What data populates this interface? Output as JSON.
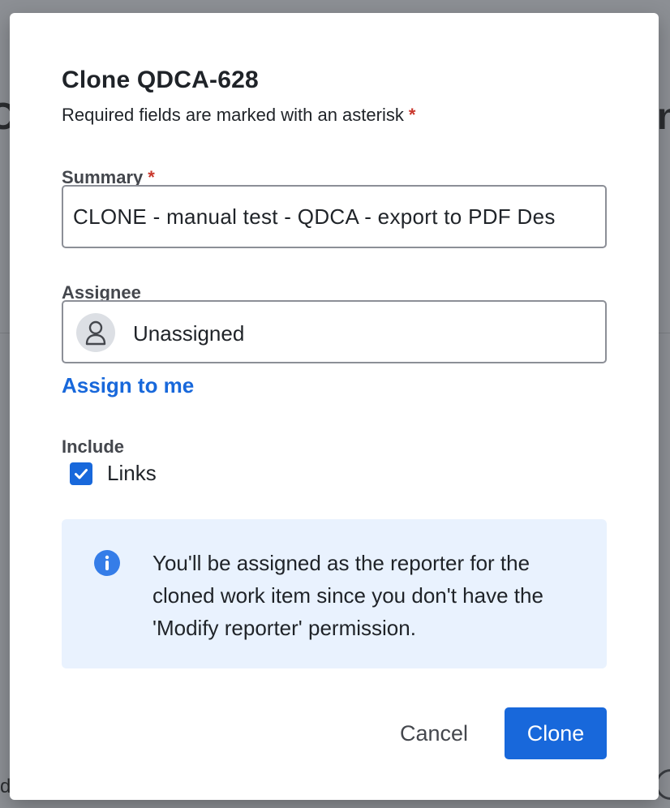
{
  "background": {
    "left_fragment": "C",
    "right_fragment": "n",
    "bottom_fragment": "d"
  },
  "dialog": {
    "title": "Clone QDCA-628",
    "required_note": "Required fields are marked with an asterisk",
    "required_marker": "*"
  },
  "summary": {
    "label": "Summary",
    "required_marker": "*",
    "value": "CLONE - manual test - QDCA - export to PDF Des"
  },
  "assignee": {
    "label": "Assignee",
    "value": "Unassigned",
    "avatar_icon": "person-icon",
    "assign_to_me": "Assign to me"
  },
  "include": {
    "label": "Include",
    "links_label": "Links",
    "links_checked": true
  },
  "info": {
    "icon": "info-icon",
    "message": "You'll be assigned as the reporter for the cloned work item since you don't have the 'Modify reporter' permission."
  },
  "actions": {
    "cancel_label": "Cancel",
    "clone_label": "Clone"
  },
  "colors": {
    "primary": "#1868db",
    "required": "#c9372c",
    "info_background": "#e9f2fe",
    "overlay": "#8c8f94"
  }
}
